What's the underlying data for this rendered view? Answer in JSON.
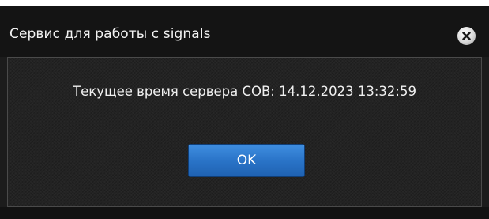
{
  "dialog": {
    "title": "Сервис для работы с signals",
    "close_icon": "close-icon",
    "message": "Текущее время сервера СОВ: 14.12.2023 13:32:59",
    "ok_label": "OK"
  },
  "colors": {
    "titlebar": "#141414",
    "content_bg": "#232323",
    "button_blue": "#2a74c8",
    "text": "#f0f0f0"
  }
}
